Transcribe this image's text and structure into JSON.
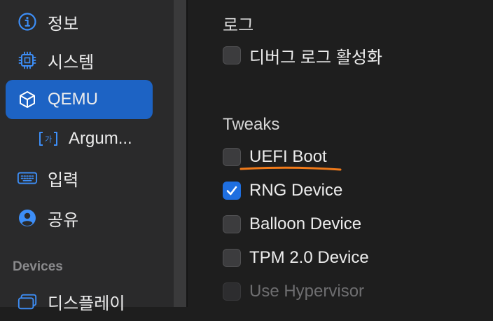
{
  "sidebar": {
    "items": [
      {
        "label": "정보",
        "icon": "info-icon"
      },
      {
        "label": "시스템",
        "icon": "cpu-chip-icon"
      },
      {
        "label": "QEMU",
        "icon": "cube-icon",
        "selected": true
      },
      {
        "label": "Argum...",
        "icon": "text-field-icon"
      },
      {
        "label": "입력",
        "icon": "keyboard-icon"
      },
      {
        "label": "공유",
        "icon": "person-circle-icon"
      },
      {
        "label": "디스플레이",
        "icon": "display-icon"
      }
    ],
    "devices_header": "Devices"
  },
  "main": {
    "log_group": {
      "title": "로그",
      "options": [
        {
          "label": "디버그 로그 활성화",
          "checked": false,
          "enabled": true
        }
      ]
    },
    "tweaks_group": {
      "title": "Tweaks",
      "options": [
        {
          "label": "UEFI Boot",
          "checked": false,
          "enabled": true,
          "annotated": true
        },
        {
          "label": "RNG Device",
          "checked": true,
          "enabled": true
        },
        {
          "label": "Balloon Device",
          "checked": false,
          "enabled": true
        },
        {
          "label": "TPM 2.0 Device",
          "checked": false,
          "enabled": true
        },
        {
          "label": "Use Hypervisor",
          "checked": false,
          "enabled": false
        }
      ]
    }
  },
  "colors": {
    "accent": "#1d63c4",
    "checkbox_checked": "#1f6fe0",
    "annotation": "#f07a1a",
    "icon_blue": "#3d8ef7"
  }
}
